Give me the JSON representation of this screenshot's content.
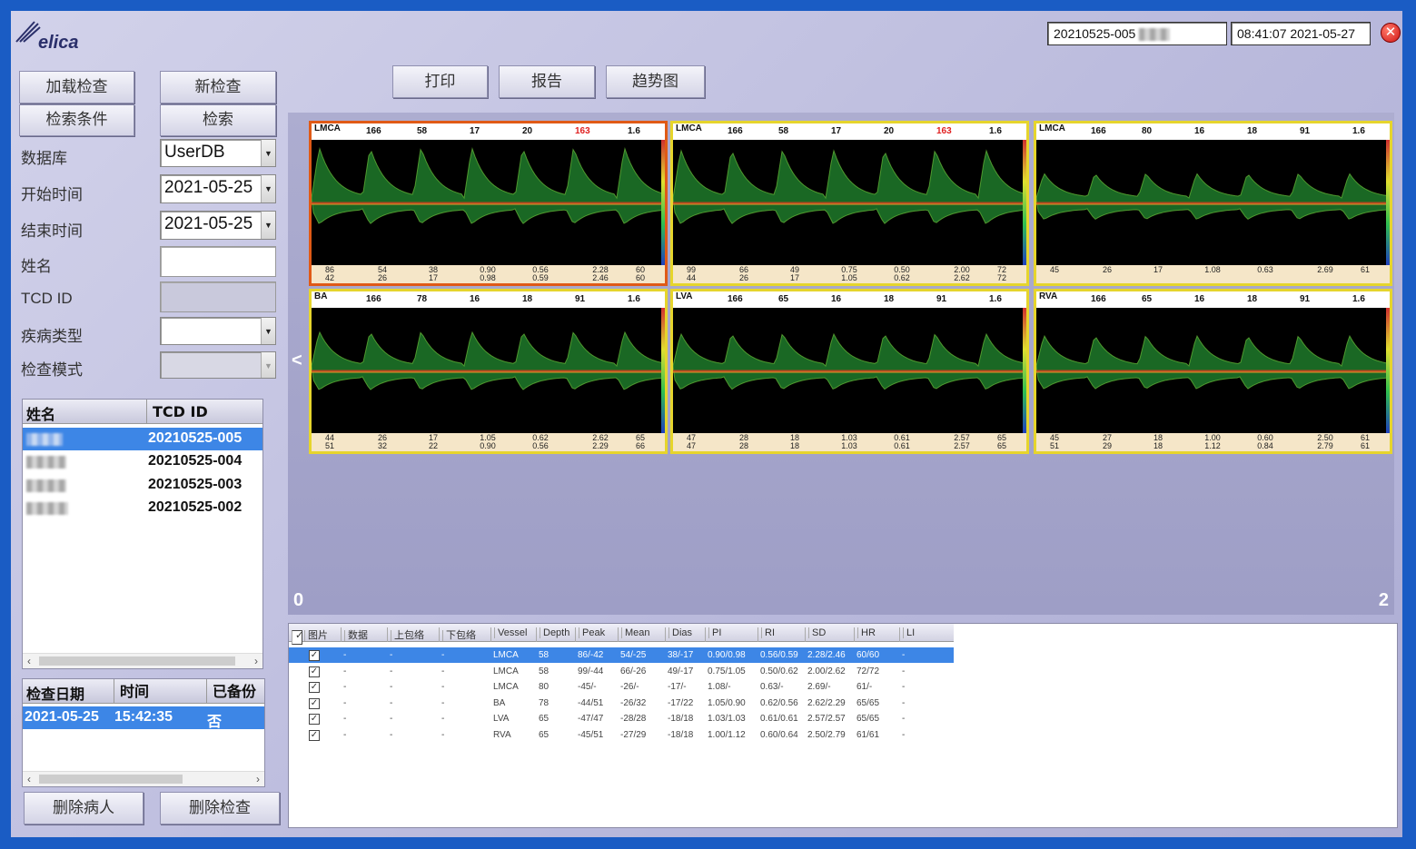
{
  "brand": {
    "logo_text": "elica"
  },
  "header": {
    "patient_id": "20210525-005",
    "datetime": "08:41:07 2021-05-27",
    "close": "✕"
  },
  "toolbar": {
    "load": "加载检查",
    "new_exam": "新检查",
    "criteria": "检索条件",
    "search": "检索",
    "print": "打印",
    "report": "报告",
    "trend": "趋势图"
  },
  "form": {
    "database_label": "数据库",
    "database_value": "UserDB",
    "start_label": "开始时间",
    "start_value": "2021-05-25",
    "end_label": "结束时间",
    "end_value": "2021-05-25",
    "name_label": "姓名",
    "tcd_label": "TCD ID",
    "disease_label": "疾病类型",
    "mode_label": "检查模式"
  },
  "patients": {
    "col_name": "姓名",
    "col_id": "TCD ID",
    "rows": [
      {
        "id": "20210525-005",
        "selected": true
      },
      {
        "id": "20210525-004",
        "selected": false
      },
      {
        "id": "20210525-003",
        "selected": false
      },
      {
        "id": "20210525-002",
        "selected": false
      }
    ]
  },
  "exams": {
    "col_date": "检查日期",
    "col_time": "时间",
    "col_backup": "已备份",
    "rows": [
      {
        "date": "2021-05-25",
        "time": "15:42:35",
        "backup": "否"
      }
    ]
  },
  "actions": {
    "delete_patient": "删除病人",
    "delete_exam": "删除检查"
  },
  "viewer": {
    "prev": "<",
    "next": ">",
    "left_index": "0",
    "right_index": "2",
    "cells": [
      {
        "vessel": "LMCA",
        "top": [
          "166",
          "58",
          "17",
          "20",
          "163",
          "1.6"
        ],
        "bot1": [
          "86",
          "54",
          "38",
          "0.90",
          "0.56",
          "2.28",
          "60"
        ],
        "bot2": [
          "42",
          "26",
          "17",
          "0.98",
          "0.59",
          "2.46",
          "60"
        ],
        "active": true,
        "density": 1.0
      },
      {
        "vessel": "LMCA",
        "top": [
          "166",
          "58",
          "17",
          "20",
          "163",
          "1.6"
        ],
        "bot1": [
          "99",
          "66",
          "49",
          "0.75",
          "0.50",
          "2.00",
          "72"
        ],
        "bot2": [
          "44",
          "26",
          "17",
          "1.05",
          "0.62",
          "2.62",
          "72"
        ],
        "active": false,
        "density": 0.95
      },
      {
        "vessel": "LMCA",
        "top": [
          "166",
          "80",
          "16",
          "18",
          "91",
          "1.6"
        ],
        "bot1": [
          "45",
          "26",
          "17",
          "1.08",
          "0.63",
          "2.69",
          "61"
        ],
        "bot2": [
          "",
          "",
          "",
          "",
          "",
          "",
          ""
        ],
        "active": false,
        "density": 0.35
      },
      {
        "vessel": "BA",
        "top": [
          "166",
          "78",
          "16",
          "18",
          "91",
          "1.6"
        ],
        "bot1": [
          "44",
          "26",
          "17",
          "1.05",
          "0.62",
          "2.62",
          "65"
        ],
        "bot2": [
          "51",
          "32",
          "22",
          "0.90",
          "0.56",
          "2.29",
          "66"
        ],
        "active": false,
        "density": 0.6
      },
      {
        "vessel": "LVA",
        "top": [
          "166",
          "65",
          "16",
          "18",
          "91",
          "1.6"
        ],
        "bot1": [
          "47",
          "28",
          "18",
          "1.03",
          "0.61",
          "2.57",
          "65"
        ],
        "bot2": [
          "47",
          "28",
          "18",
          "1.03",
          "0.61",
          "2.57",
          "65"
        ],
        "active": false,
        "density": 0.55
      },
      {
        "vessel": "RVA",
        "top": [
          "166",
          "65",
          "16",
          "18",
          "91",
          "1.6"
        ],
        "bot1": [
          "45",
          "27",
          "18",
          "1.00",
          "0.60",
          "2.50",
          "61"
        ],
        "bot2": [
          "51",
          "29",
          "18",
          "1.12",
          "0.84",
          "2.79",
          "61"
        ],
        "active": false,
        "density": 0.5
      }
    ]
  },
  "grid": {
    "headers": [
      "图片",
      "数据",
      "上包络",
      "下包络",
      "Vessel",
      "Depth",
      "Peak",
      "Mean",
      "Dias",
      "PI",
      "RI",
      "SD",
      "HR",
      "LI"
    ],
    "rows": [
      [
        "-",
        "-",
        "-",
        "LMCA",
        "58",
        "86/-42",
        "54/-25",
        "38/-17",
        "0.90/0.98",
        "0.56/0.59",
        "2.28/2.46",
        "60/60",
        "-"
      ],
      [
        "-",
        "-",
        "-",
        "LMCA",
        "58",
        "99/-44",
        "66/-26",
        "49/-17",
        "0.75/1.05",
        "0.50/0.62",
        "2.00/2.62",
        "72/72",
        "-"
      ],
      [
        "-",
        "-",
        "-",
        "LMCA",
        "80",
        "-45/-",
        "-26/-",
        "-17/-",
        "1.08/-",
        "0.63/-",
        "2.69/-",
        "61/-",
        "-"
      ],
      [
        "-",
        "-",
        "-",
        "BA",
        "78",
        "-44/51",
        "-26/32",
        "-17/22",
        "1.05/0.90",
        "0.62/0.56",
        "2.62/2.29",
        "65/65",
        "-"
      ],
      [
        "-",
        "-",
        "-",
        "LVA",
        "65",
        "-47/47",
        "-28/28",
        "-18/18",
        "1.03/1.03",
        "0.61/0.61",
        "2.57/2.57",
        "65/65",
        "-"
      ],
      [
        "-",
        "-",
        "-",
        "RVA",
        "65",
        "-45/51",
        "-27/29",
        "-18/18",
        "1.00/1.12",
        "0.60/0.64",
        "2.50/2.79",
        "61/61",
        "-"
      ]
    ]
  }
}
